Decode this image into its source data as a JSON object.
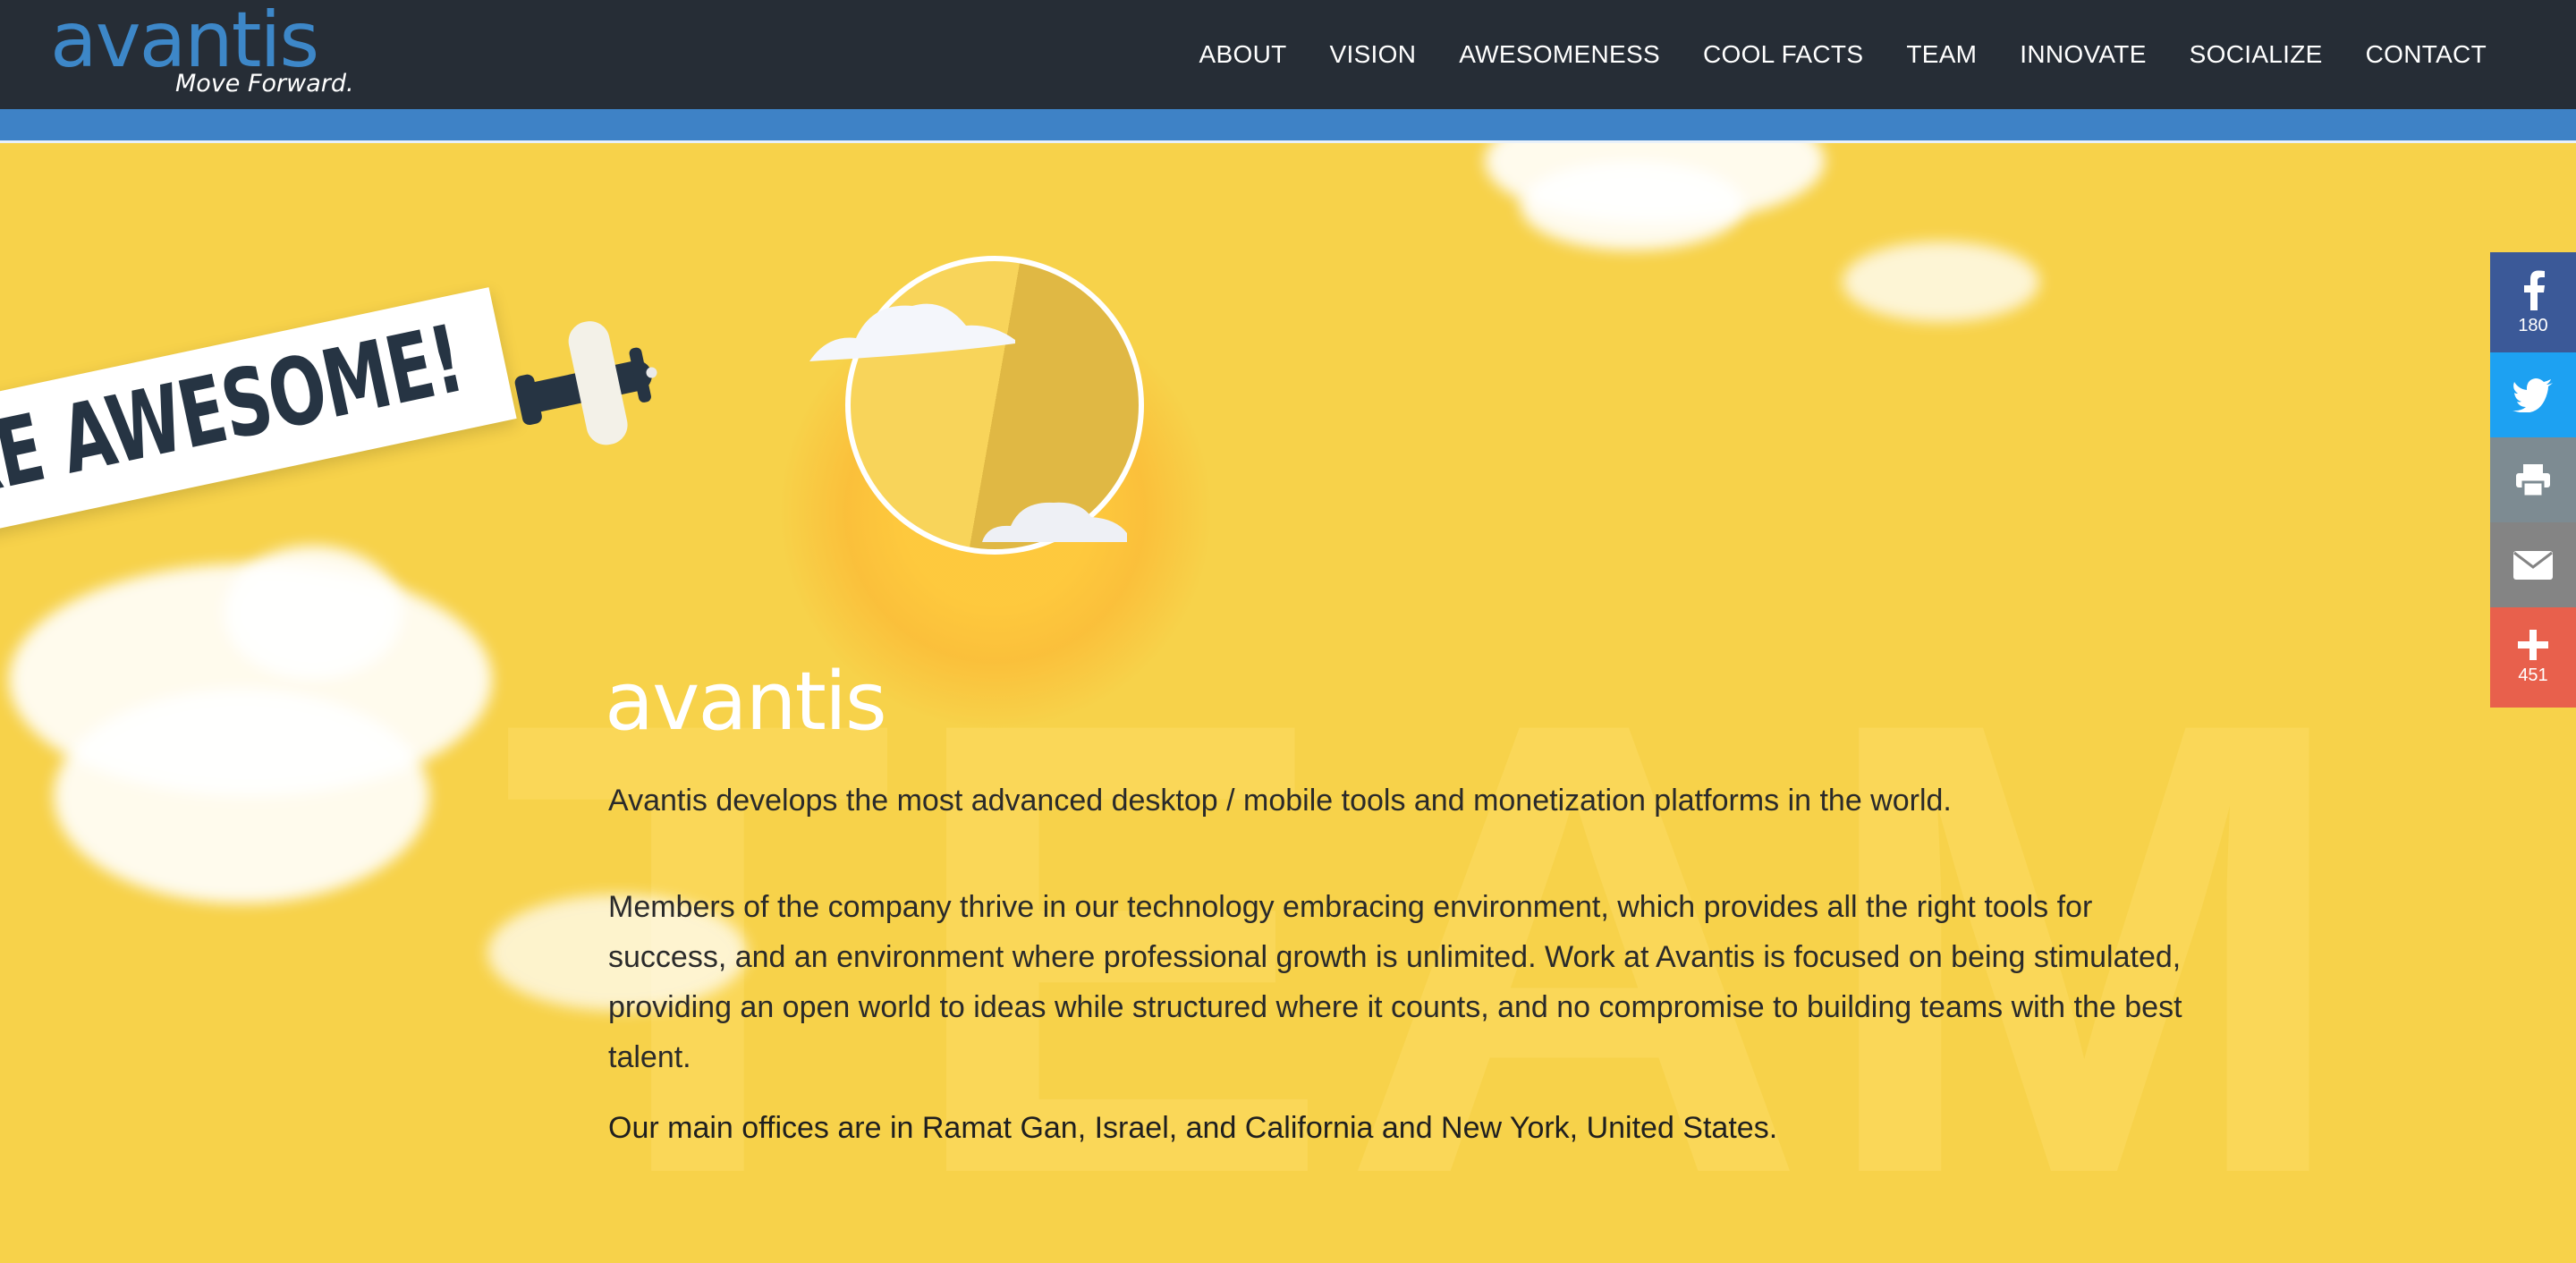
{
  "header": {
    "logo_text": "avantis",
    "logo_tagline": "Move Forward.",
    "nav": [
      "ABOUT",
      "VISION",
      "AWESOMENESS",
      "COOL FACTS",
      "TEAM",
      "INNOVATE",
      "SOCIALIZE",
      "CONTACT"
    ]
  },
  "hero": {
    "banner_text": "RE AWESOME!",
    "watermark": "TEAM",
    "brand_text": "avantis",
    "paragraph1": "Avantis develops the most advanced desktop / mobile tools and monetization platforms in the world.",
    "paragraph2": "Members of the company thrive in our technology embracing environment, which provides all the right tools for success, and an environment where professional growth is unlimited. Work at Avantis is focused on being stimulated, providing an open world to ideas while structured where it counts, and no compromise to building teams with the best talent.",
    "paragraph3": "Our main offices are in Ramat Gan, Israel, and California and New York, United States."
  },
  "share": {
    "facebook_count": "180",
    "more_count": "451",
    "icons": [
      "facebook-icon",
      "twitter-icon",
      "print-icon",
      "email-icon",
      "plus-icon"
    ]
  },
  "colors": {
    "header_bg": "#262d36",
    "accent_blue": "#3e82c6",
    "hero_yellow": "#f7d24a",
    "facebook": "#3b5998",
    "twitter": "#1da1f2",
    "print": "#7d8b92",
    "email": "#848484",
    "more": "#e8604c"
  }
}
